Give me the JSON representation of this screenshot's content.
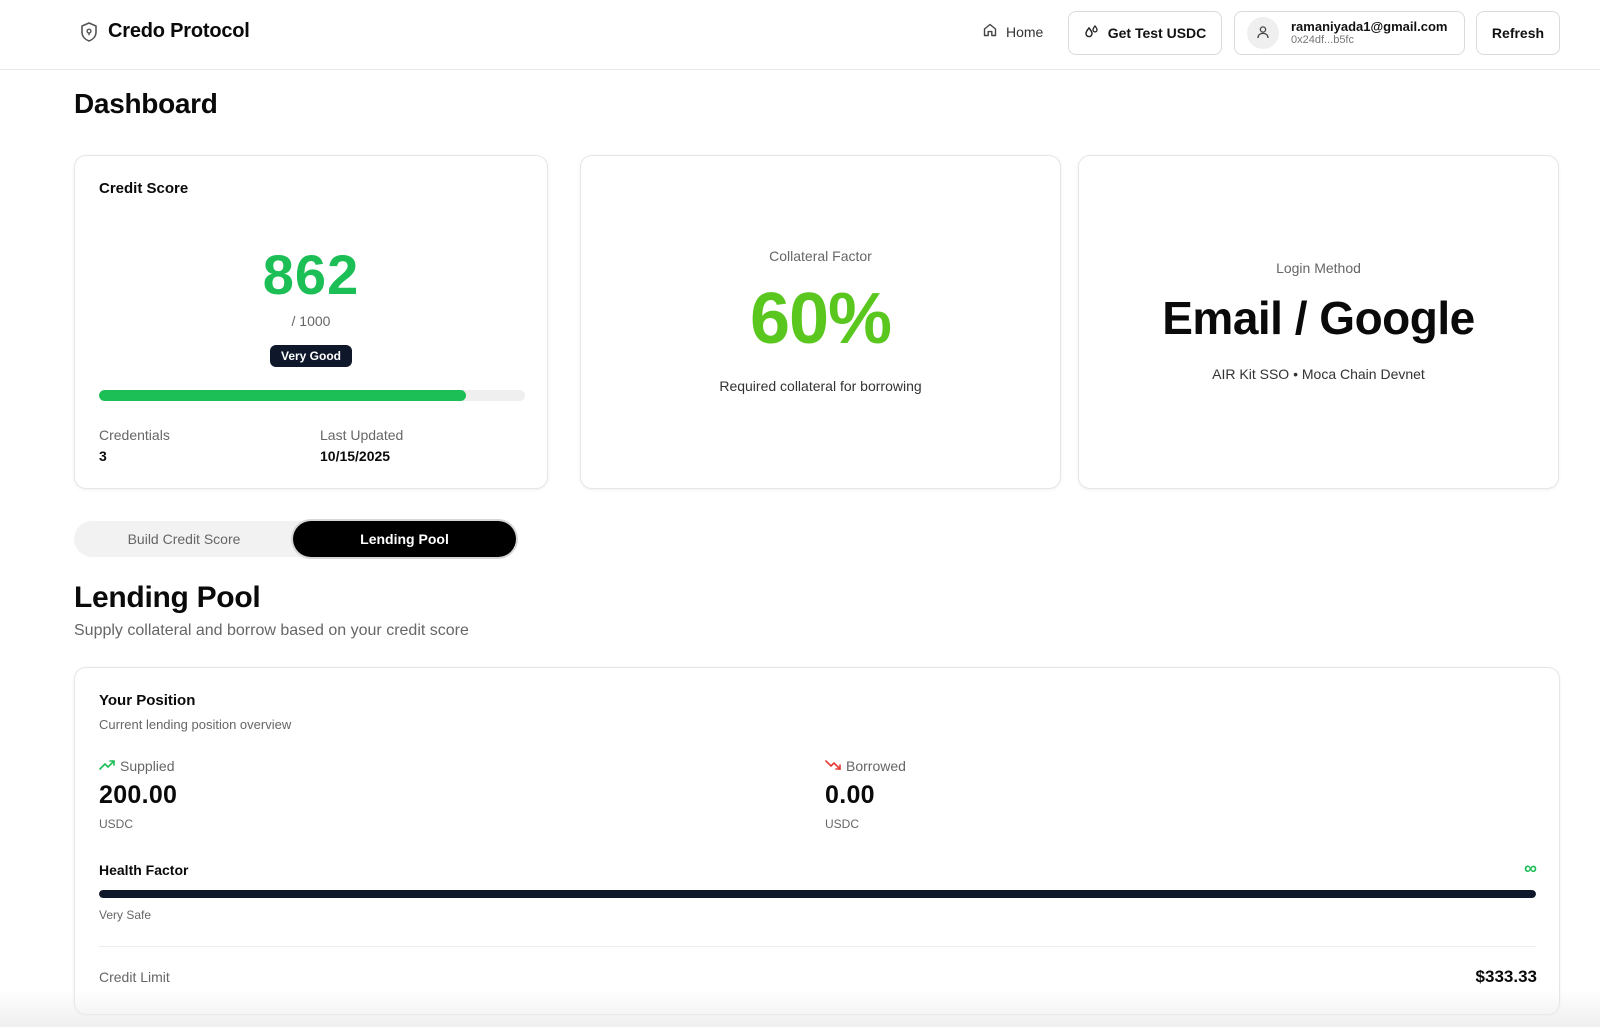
{
  "header": {
    "brand": "Credo Protocol",
    "nav_home": "Home",
    "get_usdc": "Get Test USDC",
    "user_email": "ramaniyada1@gmail.com",
    "user_address": "0x24df...b5fc",
    "refresh": "Refresh"
  },
  "page": {
    "title": "Dashboard"
  },
  "credit_score": {
    "title": "Credit Score",
    "score": "862",
    "max": "/ 1000",
    "rating": "Very Good",
    "progress_fraction": 0.862,
    "credentials_label": "Credentials",
    "credentials_value": "3",
    "updated_label": "Last Updated",
    "updated_value": "10/15/2025"
  },
  "collateral": {
    "label": "Collateral Factor",
    "value": "60%",
    "description": "Required collateral for borrowing"
  },
  "login": {
    "label": "Login Method",
    "value": "Email / Google",
    "description": "AIR Kit SSO • Moca Chain Devnet"
  },
  "tabs": [
    {
      "label": "Build Credit Score",
      "active": false
    },
    {
      "label": "Lending Pool",
      "active": true
    }
  ],
  "lending": {
    "title": "Lending Pool",
    "subtitle": "Supply collateral and borrow based on your credit score"
  },
  "position": {
    "title": "Your Position",
    "subtitle": "Current lending position overview",
    "supplied_label": "Supplied",
    "supplied_value": "200.00",
    "supplied_unit": "USDC",
    "borrowed_label": "Borrowed",
    "borrowed_value": "0.00",
    "borrowed_unit": "USDC",
    "health_label": "Health Factor",
    "health_value": "∞",
    "health_fraction": 1.0,
    "health_status": "Very Safe",
    "credit_limit_label": "Credit Limit",
    "credit_limit_value": "$333.33"
  },
  "colors": {
    "score_green": "#1bbf55",
    "collateral_green": "#5ac71f",
    "supplied_icon": "#1bbf55",
    "borrowed_icon": "#e53935",
    "dark": "#0f172a"
  },
  "icons": {
    "brand": "shield-icon",
    "home": "home-icon",
    "usdc": "faucet-drops-icon",
    "user": "user-icon",
    "supplied": "trending-up-icon",
    "borrowed": "trending-down-icon"
  }
}
